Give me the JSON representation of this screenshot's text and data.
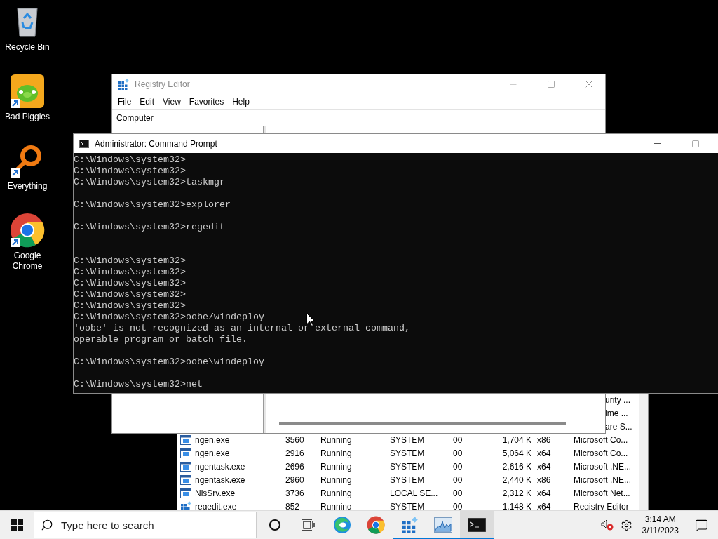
{
  "desktop_icons": [
    {
      "label": "Recycle Bin",
      "kind": "recycle"
    },
    {
      "label": "Bad Piggies",
      "kind": "game"
    },
    {
      "label": "Everything",
      "kind": "search"
    },
    {
      "label": "Google Chrome",
      "kind": "chrome"
    }
  ],
  "task_manager": {
    "rows": [
      {
        "kind": "partial",
        "description": "urity ..."
      },
      {
        "kind": "partial",
        "description": "ime ..."
      },
      {
        "kind": "partial",
        "description": "are S..."
      },
      {
        "kind": "process",
        "name": "ngen.exe",
        "pid": "3560",
        "status": "Running",
        "user": "SYSTEM",
        "cpu": "00",
        "memory": "1,704 K",
        "arch": "x86",
        "description": "Microsoft Co..."
      },
      {
        "kind": "process",
        "name": "ngen.exe",
        "pid": "2916",
        "status": "Running",
        "user": "SYSTEM",
        "cpu": "00",
        "memory": "5,064 K",
        "arch": "x64",
        "description": "Microsoft Co..."
      },
      {
        "kind": "process",
        "name": "ngentask.exe",
        "pid": "2696",
        "status": "Running",
        "user": "SYSTEM",
        "cpu": "00",
        "memory": "2,616 K",
        "arch": "x64",
        "description": "Microsoft .NE..."
      },
      {
        "kind": "process",
        "name": "ngentask.exe",
        "pid": "2960",
        "status": "Running",
        "user": "SYSTEM",
        "cpu": "00",
        "memory": "2,440 K",
        "arch": "x86",
        "description": "Microsoft .NE..."
      },
      {
        "kind": "process",
        "name": "NisSrv.exe",
        "pid": "3736",
        "status": "Running",
        "user": "LOCAL SE...",
        "cpu": "00",
        "memory": "2,312 K",
        "arch": "x64",
        "description": "Microsoft Net..."
      },
      {
        "kind": "registry_process",
        "name": "regedit.exe",
        "pid": "852",
        "status": "Running",
        "user": "SYSTEM",
        "cpu": "00",
        "memory": "1,148 K",
        "arch": "x64",
        "description": "Registry Editor"
      }
    ]
  },
  "registry_editor": {
    "title": "Registry Editor",
    "menu": [
      "File",
      "Edit",
      "View",
      "Favorites",
      "Help"
    ],
    "address": "Computer"
  },
  "command_prompt": {
    "title": "Administrator:  Command Prompt",
    "output": "C:\\Windows\\system32>\nC:\\Windows\\system32>\nC:\\Windows\\system32>taskmgr\n\nC:\\Windows\\system32>explorer\n\nC:\\Windows\\system32>regedit\n\n\nC:\\Windows\\system32>\nC:\\Windows\\system32>\nC:\\Windows\\system32>\nC:\\Windows\\system32>\nC:\\Windows\\system32>\nC:\\Windows\\system32>oobe/windeploy\n'oobe' is not recognized as an internal or external command,\noperable program or batch file.\n\nC:\\Windows\\system32>oobe\\windeploy\n\nC:\\Windows\\system32>net"
  },
  "taskbar": {
    "search_placeholder": "Type here to search",
    "apps": [
      {
        "kind": "edge",
        "running": false,
        "selected": false
      },
      {
        "kind": "chrome",
        "running": false,
        "selected": false
      },
      {
        "kind": "registry",
        "running": true,
        "selected": false
      },
      {
        "kind": "monitor",
        "running": true,
        "selected": false
      },
      {
        "kind": "console",
        "running": true,
        "selected": true
      }
    ],
    "time": "3:14 AM",
    "date": "3/11/2023"
  }
}
